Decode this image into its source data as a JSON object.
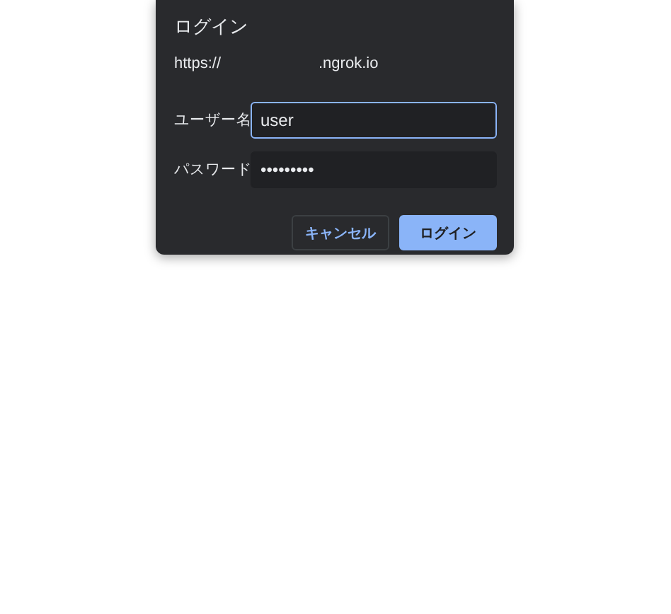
{
  "dialog": {
    "title": "ログイン",
    "url": {
      "scheme": "https://",
      "host": ".ngrok.io"
    },
    "fields": [
      {
        "label": "ユーザー名",
        "value": "user",
        "focused": true
      },
      {
        "label": "パスワード",
        "value": "•••••••••",
        "focused": false
      }
    ],
    "buttons": [
      {
        "label": "キャンセル",
        "kind": "secondary"
      },
      {
        "label": "ログイン",
        "kind": "primary"
      }
    ]
  }
}
